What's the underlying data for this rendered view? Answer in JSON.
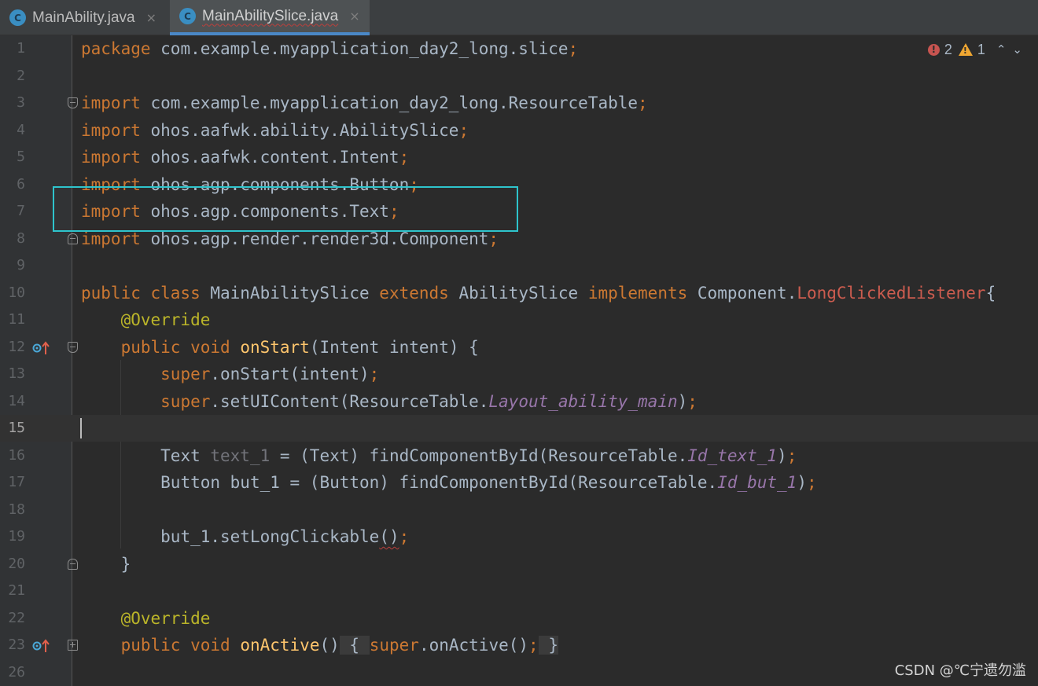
{
  "tabs": [
    {
      "label": "MainAbility.java",
      "icon": "java-class-icon",
      "icon_letter": "C",
      "active": false
    },
    {
      "label": "MainAbilitySlice.java",
      "icon": "java-class-icon",
      "icon_letter": "C",
      "active": true
    }
  ],
  "tab_close_glyph": "×",
  "inspection": {
    "error_count": "2",
    "warning_count": "1",
    "error_glyph": "!",
    "warning_glyph": "!",
    "up_glyph": "⌃",
    "down_glyph": "⌄"
  },
  "editor": {
    "current_line": "15",
    "lines": [
      {
        "n": "1"
      },
      {
        "n": "2"
      },
      {
        "n": "3"
      },
      {
        "n": "4"
      },
      {
        "n": "5"
      },
      {
        "n": "6"
      },
      {
        "n": "7"
      },
      {
        "n": "8"
      },
      {
        "n": "9"
      },
      {
        "n": "10"
      },
      {
        "n": "11"
      },
      {
        "n": "12"
      },
      {
        "n": "13"
      },
      {
        "n": "14"
      },
      {
        "n": "15"
      },
      {
        "n": "16"
      },
      {
        "n": "17"
      },
      {
        "n": "18"
      },
      {
        "n": "19"
      },
      {
        "n": "20"
      },
      {
        "n": "21"
      },
      {
        "n": "22"
      },
      {
        "n": "23"
      },
      {
        "n": "26"
      }
    ],
    "code": {
      "l1": {
        "kw": "package",
        "rest": " com.example.myapplication_day2_long.slice",
        "semi": ";"
      },
      "l3": {
        "kw": "import",
        "rest": " com.example.myapplication_day2_long.ResourceTable",
        "semi": ";"
      },
      "l4": {
        "kw": "import",
        "rest": " ohos.aafwk.ability.AbilitySlice",
        "semi": ";"
      },
      "l5": {
        "kw": "import",
        "rest": " ohos.aafwk.content.Intent",
        "semi": ";"
      },
      "l6": {
        "kw": "import",
        "rest": " ohos.agp.components.Button",
        "semi": ";"
      },
      "l7": {
        "kw": "import",
        "rest": " ohos.agp.components.Text",
        "semi": ";"
      },
      "l8": {
        "kw": "import",
        "rest": " ohos.agp.render.render3d.Component",
        "semi": ";"
      },
      "l10": {
        "kw1": "public class",
        "cls": " MainAbilitySlice ",
        "kw2": "extends",
        "parent": " AbilitySlice ",
        "kw3": "implements",
        "iface": " Component.",
        "err": "LongClickedListener",
        "brace": "{"
      },
      "l11": {
        "ann": "@Override"
      },
      "l12": {
        "kw": "public void",
        "fn": "onStart",
        "rest": "(Intent intent) {"
      },
      "l13": {
        "kw": "super",
        "rest": ".onStart(intent)",
        "semi": ";"
      },
      "l14": {
        "kw": "super",
        "rest": ".setUIContent(ResourceTable.",
        "fld": "Layout_ability_main",
        "close": ")",
        "semi": ";"
      },
      "l16": {
        "a": "Text ",
        "unused": "text_1",
        "b": " = (Text) findComponentById(ResourceTable.",
        "fld": "Id_text_1",
        "close": ")",
        "semi": ";"
      },
      "l17": {
        "a": "Button but_1 = (Button) findComponentById(ResourceTable.",
        "fld": "Id_but_1",
        "close": ")",
        "semi": ";"
      },
      "l19": {
        "a": "but_1.setLongClickable",
        "sq": "()",
        "semi": ";"
      },
      "l20": {
        "brace": "}"
      },
      "l22": {
        "ann": "@Override"
      },
      "l23": {
        "kw": "public void",
        "fn": "onActive",
        "paren": "()",
        "ob": "{",
        "kw2": "super",
        "call": ".onActive()",
        "semi": ";",
        "cb": "}"
      }
    }
  },
  "watermark": "CSDN @℃宁遗勿滥"
}
